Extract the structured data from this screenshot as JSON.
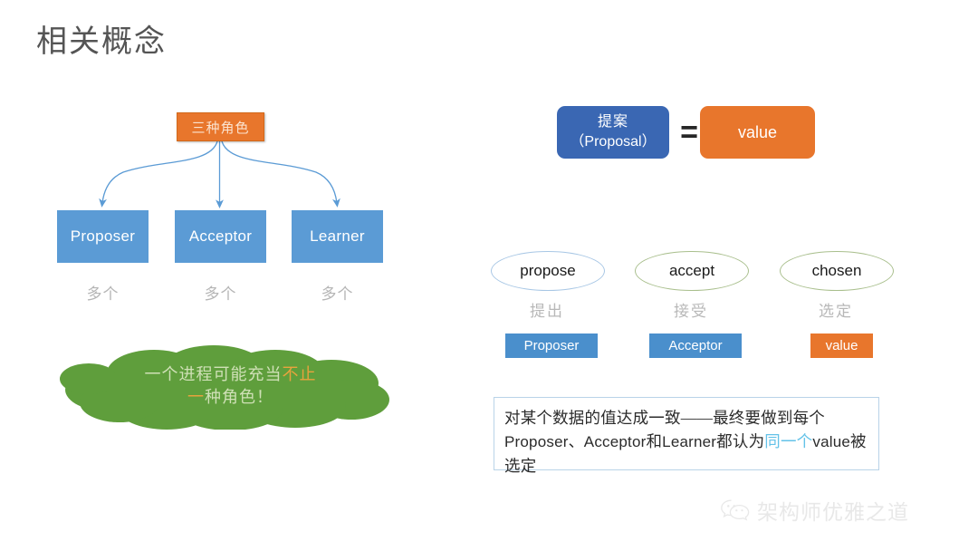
{
  "slide": {
    "title": "相关概念",
    "background_color": "#ffffff"
  },
  "colors": {
    "orange": "#e8762c",
    "blue": "#5b9bd5",
    "deep_blue": "#3a67b3",
    "green_cloud": "#5f9e3c",
    "highlight_gold": "#e8a33d",
    "highlight_cyan": "#63c2e8",
    "muted_gray": "#b5b5b5",
    "title_gray": "#545454"
  },
  "left": {
    "head_box": {
      "label": "三种角色"
    },
    "roles": [
      {
        "name": "Proposer",
        "count_label": "多个"
      },
      {
        "name": "Acceptor",
        "count_label": "多个"
      },
      {
        "name": "Learner",
        "count_label": "多个"
      }
    ],
    "cloud": {
      "line1_plain": "一个进程可能充当",
      "line1_highlight": "不止",
      "line2_highlight": "一",
      "line2_plain": "种角色！"
    }
  },
  "right": {
    "equation": {
      "left_box_line1": "提案",
      "left_box_line2": "（Proposal）",
      "operator": "=",
      "right_box": "value"
    },
    "actions": [
      {
        "term": "propose",
        "translation": "提出",
        "actor": "Proposer",
        "actor_color": "#4a8fcc",
        "ellipse_border": "#a8c7e5"
      },
      {
        "term": "accept",
        "translation": "接受",
        "actor": "Acceptor",
        "actor_color": "#4a8fcc",
        "ellipse_border": "#a9bf8d"
      },
      {
        "term": "chosen",
        "translation": "选定",
        "actor": "value",
        "actor_color": "#e8762c",
        "ellipse_border": "#a9bf8d"
      }
    ],
    "note": {
      "seg1": "对某个数据的值达成一致——最终要做到每个",
      "seg2": "Proposer、Acceptor",
      "seg3": "和",
      "seg4": "Learner",
      "seg5": "都认为",
      "seg6_highlight": "同一个",
      "seg7": "value",
      "seg8": "被选定"
    }
  },
  "watermark": {
    "icon": "wechat-icon",
    "text": "架构师优雅之道"
  }
}
